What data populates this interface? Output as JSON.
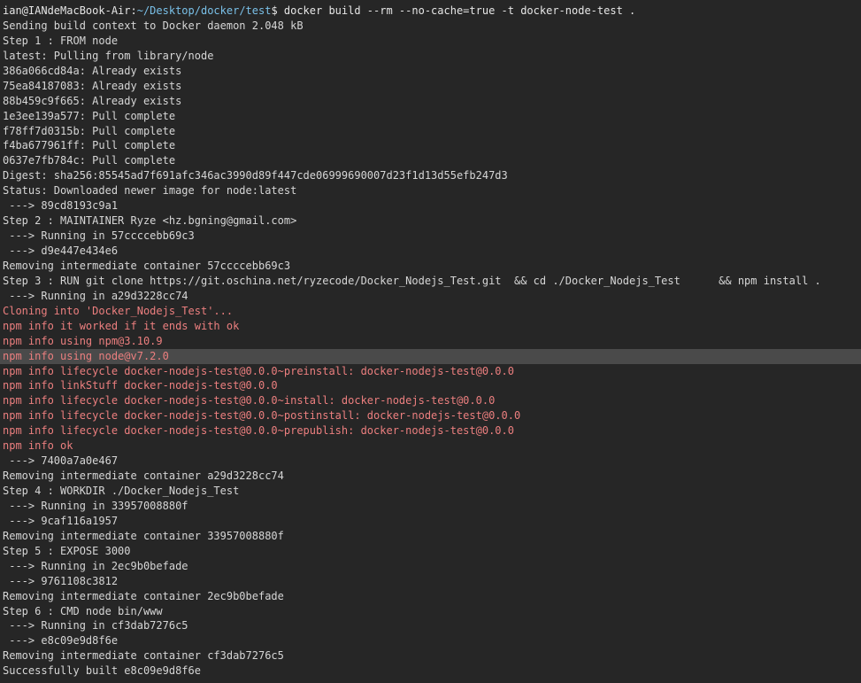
{
  "terminal": {
    "prompt": {
      "user_host": "ian@IANdeMacBook-Air:",
      "path": "~/Desktop/docker/test",
      "command": "$ docker build --rm --no-cache=true -t docker-node-test ."
    },
    "colors": {
      "background": "#262626",
      "text": "#d6d6d6",
      "error_text": "#ec7f7f",
      "path": "#7ac0e8",
      "highlight": "#4a4a4a"
    },
    "lines": [
      {
        "text": "Sending build context to Docker daemon 2.048 kB",
        "type": "normal"
      },
      {
        "text": "Step 1 : FROM node",
        "type": "normal"
      },
      {
        "text": "latest: Pulling from library/node",
        "type": "normal"
      },
      {
        "text": "386a066cd84a: Already exists",
        "type": "normal"
      },
      {
        "text": "75ea84187083: Already exists",
        "type": "normal"
      },
      {
        "text": "88b459c9f665: Already exists",
        "type": "normal"
      },
      {
        "text": "1e3ee139a577: Pull complete",
        "type": "normal"
      },
      {
        "text": "f78ff7d0315b: Pull complete",
        "type": "normal"
      },
      {
        "text": "f4ba677961ff: Pull complete",
        "type": "normal"
      },
      {
        "text": "0637e7fb784c: Pull complete",
        "type": "normal"
      },
      {
        "text": "Digest: sha256:85545ad7f691afc346ac3990d89f447cde06999690007d23f1d13d55efb247d3",
        "type": "normal"
      },
      {
        "text": "Status: Downloaded newer image for node:latest",
        "type": "normal"
      },
      {
        "text": " ---> 89cd8193c9a1",
        "type": "normal"
      },
      {
        "text": "Step 2 : MAINTAINER Ryze <hz.bgning@gmail.com>",
        "type": "normal"
      },
      {
        "text": " ---> Running in 57ccccebb69c3",
        "type": "normal"
      },
      {
        "text": " ---> d9e447e434e6",
        "type": "normal"
      },
      {
        "text": "Removing intermediate container 57ccccebb69c3",
        "type": "normal"
      },
      {
        "text": "Step 3 : RUN git clone https://git.oschina.net/ryzecode/Docker_Nodejs_Test.git  && cd ./Docker_Nodejs_Test      && npm install .",
        "type": "normal"
      },
      {
        "text": " ---> Running in a29d3228cc74",
        "type": "normal"
      },
      {
        "text": "Cloning into 'Docker_Nodejs_Test'...",
        "type": "red"
      },
      {
        "text": "npm info it worked if it ends with ok",
        "type": "red"
      },
      {
        "text": "npm info using npm@3.10.9",
        "type": "red"
      },
      {
        "text": "npm info using node@v7.2.0",
        "type": "red-highlight"
      },
      {
        "text": "npm info lifecycle docker-nodejs-test@0.0.0~preinstall: docker-nodejs-test@0.0.0",
        "type": "red"
      },
      {
        "text": "npm info linkStuff docker-nodejs-test@0.0.0",
        "type": "red"
      },
      {
        "text": "npm info lifecycle docker-nodejs-test@0.0.0~install: docker-nodejs-test@0.0.0",
        "type": "red"
      },
      {
        "text": "npm info lifecycle docker-nodejs-test@0.0.0~postinstall: docker-nodejs-test@0.0.0",
        "type": "red"
      },
      {
        "text": "npm info lifecycle docker-nodejs-test@0.0.0~prepublish: docker-nodejs-test@0.0.0",
        "type": "red"
      },
      {
        "text": "npm info ok",
        "type": "red"
      },
      {
        "text": " ---> 7400a7a0e467",
        "type": "normal"
      },
      {
        "text": "Removing intermediate container a29d3228cc74",
        "type": "normal"
      },
      {
        "text": "Step 4 : WORKDIR ./Docker_Nodejs_Test",
        "type": "normal"
      },
      {
        "text": " ---> Running in 33957008880f",
        "type": "normal"
      },
      {
        "text": " ---> 9caf116a1957",
        "type": "normal"
      },
      {
        "text": "Removing intermediate container 33957008880f",
        "type": "normal"
      },
      {
        "text": "Step 5 : EXPOSE 3000",
        "type": "normal"
      },
      {
        "text": " ---> Running in 2ec9b0befade",
        "type": "normal"
      },
      {
        "text": " ---> 9761108c3812",
        "type": "normal"
      },
      {
        "text": "Removing intermediate container 2ec9b0befade",
        "type": "normal"
      },
      {
        "text": "Step 6 : CMD node bin/www",
        "type": "normal"
      },
      {
        "text": " ---> Running in cf3dab7276c5",
        "type": "normal"
      },
      {
        "text": " ---> e8c09e9d8f6e",
        "type": "normal"
      },
      {
        "text": "Removing intermediate container cf3dab7276c5",
        "type": "normal"
      },
      {
        "text": "Successfully built e8c09e9d8f6e",
        "type": "normal"
      }
    ]
  }
}
